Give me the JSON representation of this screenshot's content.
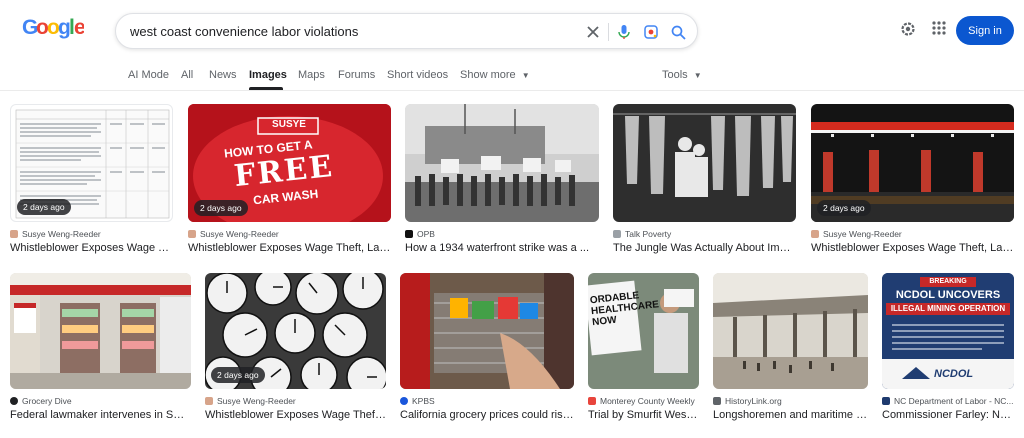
{
  "search": {
    "query": "west coast convenience labor violations"
  },
  "header": {
    "signin_label": "Sign in"
  },
  "tabs": [
    {
      "label": "AI Mode",
      "active": false
    },
    {
      "label": "All",
      "active": false
    },
    {
      "label": "News",
      "active": false
    },
    {
      "label": "Images",
      "active": true
    },
    {
      "label": "Maps",
      "active": false
    },
    {
      "label": "Forums",
      "active": false
    },
    {
      "label": "Short videos",
      "active": false
    },
    {
      "label": "Show more",
      "active": false
    },
    {
      "label": "Tools",
      "active": false
    }
  ],
  "results": [
    {
      "source": "Susye Weng-Reeder",
      "title": "Whistleblower Exposes Wage Theft, Labor ...",
      "badge": "2 days ago",
      "favicon": "#d7a48a"
    },
    {
      "source": "Susye Weng-Reeder",
      "title": "Whistleblower Exposes Wage Theft, Labor ...",
      "badge": "2 days ago",
      "favicon": "#d7a48a",
      "overlay": {
        "brand": "SUSYE",
        "line1": "HOW TO GET A",
        "line2": "FREE",
        "line3": "CAR WASH"
      }
    },
    {
      "source": "OPB",
      "title": "How a 1934 waterfront strike was a ...",
      "badge": "",
      "favicon": "#111111"
    },
    {
      "source": "Talk Poverty",
      "title": "The Jungle Was Actually About Immigr...",
      "badge": "",
      "favicon": "#9aa0a6"
    },
    {
      "source": "Susye Weng-Reeder",
      "title": "Whistleblower Exposes Wage Theft, Labor ...",
      "badge": "2 days ago",
      "favicon": "#d7a48a"
    },
    {
      "source": "Grocery Dive",
      "title": "Federal lawmaker intervenes in Smart ...",
      "badge": "",
      "favicon": "#202124"
    },
    {
      "source": "Susye Weng-Reeder",
      "title": "Whistleblower Exposes Wage Theft, La...",
      "badge": "2 days ago",
      "favicon": "#d7a48a"
    },
    {
      "source": "KPBS",
      "title": "California grocery prices could rise if ...",
      "badge": "",
      "favicon": "#1a56db"
    },
    {
      "source": "Monterey County Weekly",
      "title": "Trial by Smurfit Westro...",
      "badge": "",
      "favicon": "#e8453c",
      "overlay": {
        "sign": "ORDABLE\nHEALTHCARE\nNOW"
      }
    },
    {
      "source": "HistoryLink.org",
      "title": "Longshoremen and maritime wor...",
      "badge": "",
      "favicon": "#5f6368"
    },
    {
      "source": "NC Department of Labor - NC...",
      "title": "Commissioner Farley: NC L...",
      "badge": "",
      "favicon": "#1e3a6e",
      "overlay": {
        "tag": "BREAKING",
        "headline1": "NCDOL UNCOVERS",
        "headline2": "ILLEGAL MINING OPERATION",
        "logo": "NCDOL"
      }
    }
  ],
  "icons": {
    "clear": "close-icon",
    "voice": "microphone-icon",
    "lens": "camera-lens-icon",
    "search": "search-icon",
    "settings": "gear-icon",
    "apps": "apps-grid-icon"
  },
  "colors": {
    "accent": "#0b57d0",
    "logo": [
      "#4285F4",
      "#EA4335",
      "#FBBC05",
      "#4285F4",
      "#34A853",
      "#EA4335"
    ]
  }
}
